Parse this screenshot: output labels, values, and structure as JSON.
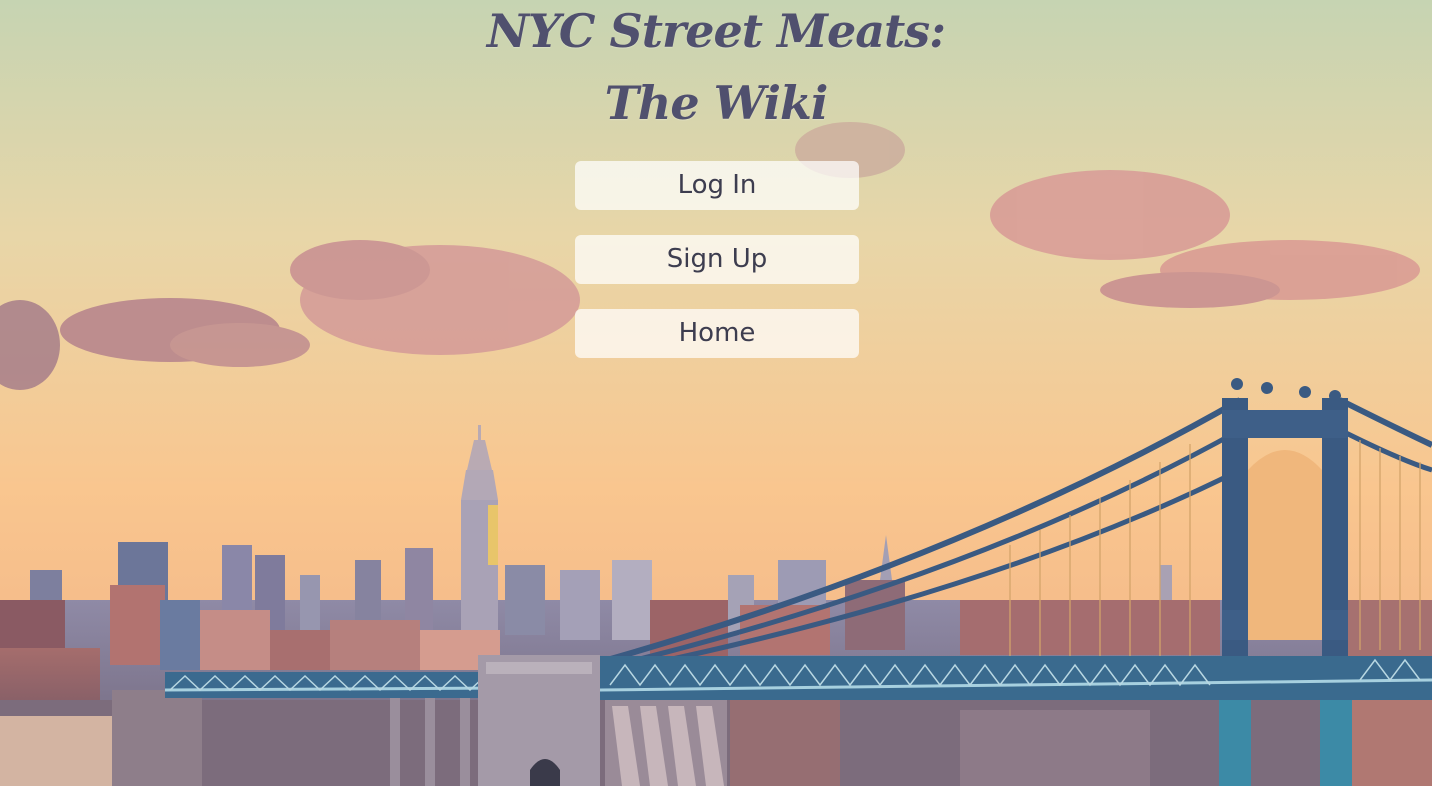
{
  "header": {
    "title_line_1": "NYC Street Meats:",
    "title_line_2": "The Wiki"
  },
  "nav": {
    "login_label": "Log In",
    "signup_label": "Sign Up",
    "home_label": "Home"
  },
  "theme": {
    "title_color": "#50506e",
    "button_bg": "#ffffffb8",
    "button_text": "#3d3d4f",
    "sky_top": "#c8d2ae",
    "sky_bottom": "#f6c08c",
    "bridge_color": "#3a5f86"
  }
}
